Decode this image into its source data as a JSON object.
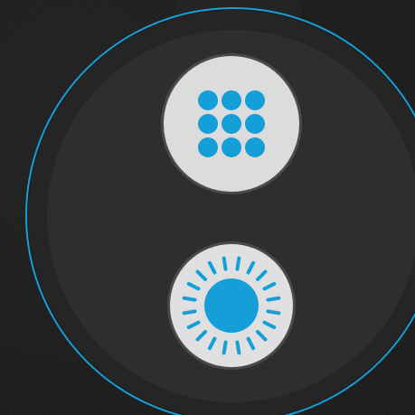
{
  "theme": {
    "accent": "#159fd8",
    "background": "#1e1e1e",
    "watch_face": "#2e2e2e",
    "button_fill": "#dcdcdc"
  },
  "controls": {
    "apps_button": {
      "icon": "app-grid-icon"
    },
    "brightness_button": {
      "icon": "brightness-icon"
    }
  }
}
